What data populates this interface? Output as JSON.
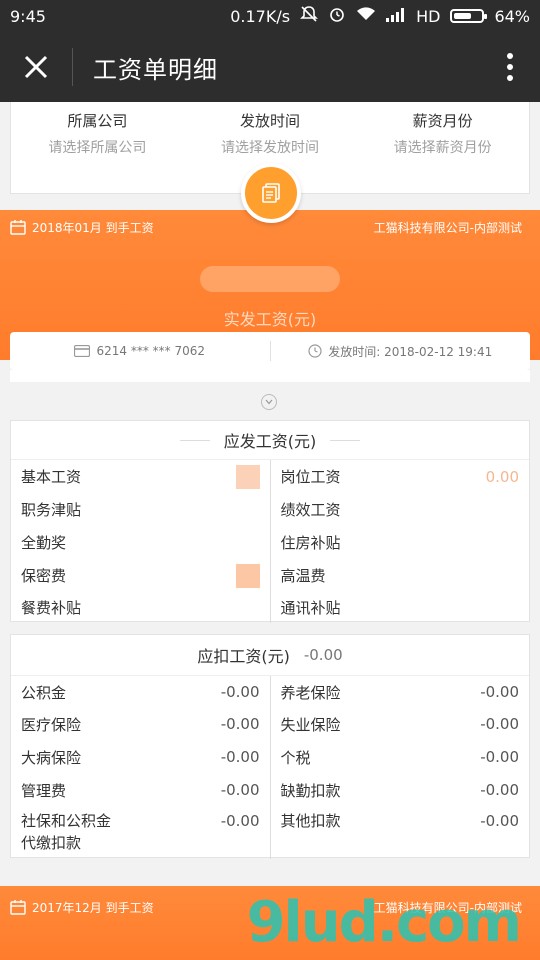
{
  "status_bar": {
    "time": "9:45",
    "network_speed": "0.17K/s",
    "hd_label": "HD",
    "battery_percent": "64%",
    "battery_level": 0.64
  },
  "header": {
    "title": "工资单明细"
  },
  "filters": [
    {
      "label": "所属公司",
      "placeholder": "请选择所属公司"
    },
    {
      "label": "发放时间",
      "placeholder": "请选择发放时间"
    },
    {
      "label": "薪资月份",
      "placeholder": "请选择薪资月份"
    }
  ],
  "payslip": {
    "period": "2018年01月 到手工资",
    "company": "工猫科技有限公司-内部测试",
    "amount_label": "实发工资(元)",
    "bank_card": "6214 *** *** 7062",
    "pay_time": "发放时间: 2018-02-12 19:41"
  },
  "gross_section": {
    "title": "应发工资(元)",
    "left": [
      {
        "label": "基本工资"
      },
      {
        "label": "职务津贴"
      },
      {
        "label": "全勤奖"
      },
      {
        "label": "保密费"
      },
      {
        "label": "餐费补贴"
      }
    ],
    "right": [
      {
        "label": "岗位工资",
        "value": "0.00"
      },
      {
        "label": "绩效工资"
      },
      {
        "label": "住房补贴"
      },
      {
        "label": "高温费"
      },
      {
        "label": "通讯补贴"
      }
    ]
  },
  "deduct_section": {
    "title": "应扣工资(元)",
    "total": "-0.00",
    "left": [
      {
        "label": "公积金",
        "value": "-0.00"
      },
      {
        "label": "医疗保险",
        "value": "-0.00"
      },
      {
        "label": "大病保险",
        "value": "-0.00"
      },
      {
        "label": "管理费",
        "value": "-0.00"
      },
      {
        "label": "社保和公积金\n代缴扣款",
        "value": "-0.00"
      }
    ],
    "right": [
      {
        "label": "养老保险",
        "value": "-0.00"
      },
      {
        "label": "失业保险",
        "value": "-0.00"
      },
      {
        "label": "个税",
        "value": "-0.00"
      },
      {
        "label": "缺勤扣款",
        "value": "-0.00"
      },
      {
        "label": "其他扣款",
        "value": "-0.00"
      }
    ]
  },
  "next_payslip": {
    "period": "2017年12月 到手工资",
    "company": "工猫科技有限公司-内部测试"
  },
  "watermark_text": "9lud.com",
  "colors": {
    "accent_orange": "#ff7c2c",
    "fab_orange": "#ff9f2e",
    "dark_bar": "#2d2d2d"
  }
}
